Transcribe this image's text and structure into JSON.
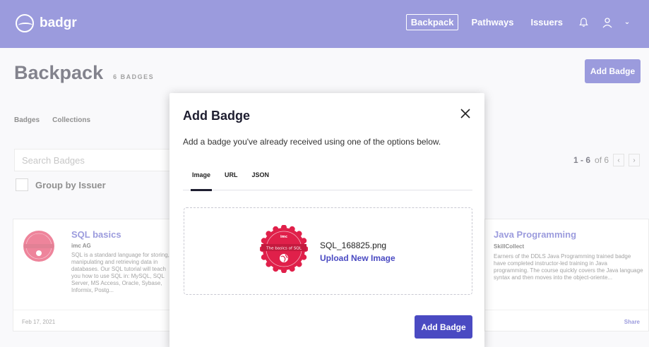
{
  "app": {
    "brand": "badgr",
    "nav": [
      {
        "label": "Backpack",
        "active": true
      },
      {
        "label": "Pathways",
        "active": false
      },
      {
        "label": "Issuers",
        "active": false
      }
    ],
    "icons": {
      "notifications": "bell-icon",
      "account": "user-icon",
      "chevron": "chevron-down-icon"
    },
    "accent_color": "#4a4ac2"
  },
  "page": {
    "title": "Backpack",
    "badge_count": "6 BADGES",
    "add_badge_label": "Add Badge",
    "subtabs": [
      "Badges",
      "Collections"
    ],
    "search_placeholder": "Search Badges",
    "group_by_label": "Group by Issuer",
    "pager": {
      "range": "1 - 6",
      "of": "of 6"
    }
  },
  "cards": [
    {
      "title": "SQL basics",
      "issuer": "imc AG",
      "description": "SQL is a standard language for storing, manipulating and retrieving data in databases. Our SQL tutorial will teach you how to use SQL in: MySQL, SQL Server, MS Access, Oracle, Sybase, Informix, Postg...",
      "date": "Feb 17, 2021",
      "seal_text": "The basics of SQL"
    },
    {
      "title": "Java Programming",
      "issuer": "SkillCollect",
      "description": "Earners of the DDLS Java Programming trained badge have completed instructor-led training in Java programming. The course quickly covers the Java language syntax and then moves into the object-oriente...",
      "share_label": "Share"
    }
  ],
  "modal": {
    "title": "Add Badge",
    "description": "Add a badge you've already received using one of the options below.",
    "tabs": [
      {
        "label": "Image",
        "active": true
      },
      {
        "label": "URL",
        "active": false
      },
      {
        "label": "JSON",
        "active": false
      }
    ],
    "upload": {
      "filename": "SQL_168825.png",
      "link_label": "Upload New Image",
      "seal_text": "The basics of SQL",
      "seal_brand": "imc"
    },
    "submit_label": "Add Badge",
    "seal_color": "#e0204a"
  }
}
